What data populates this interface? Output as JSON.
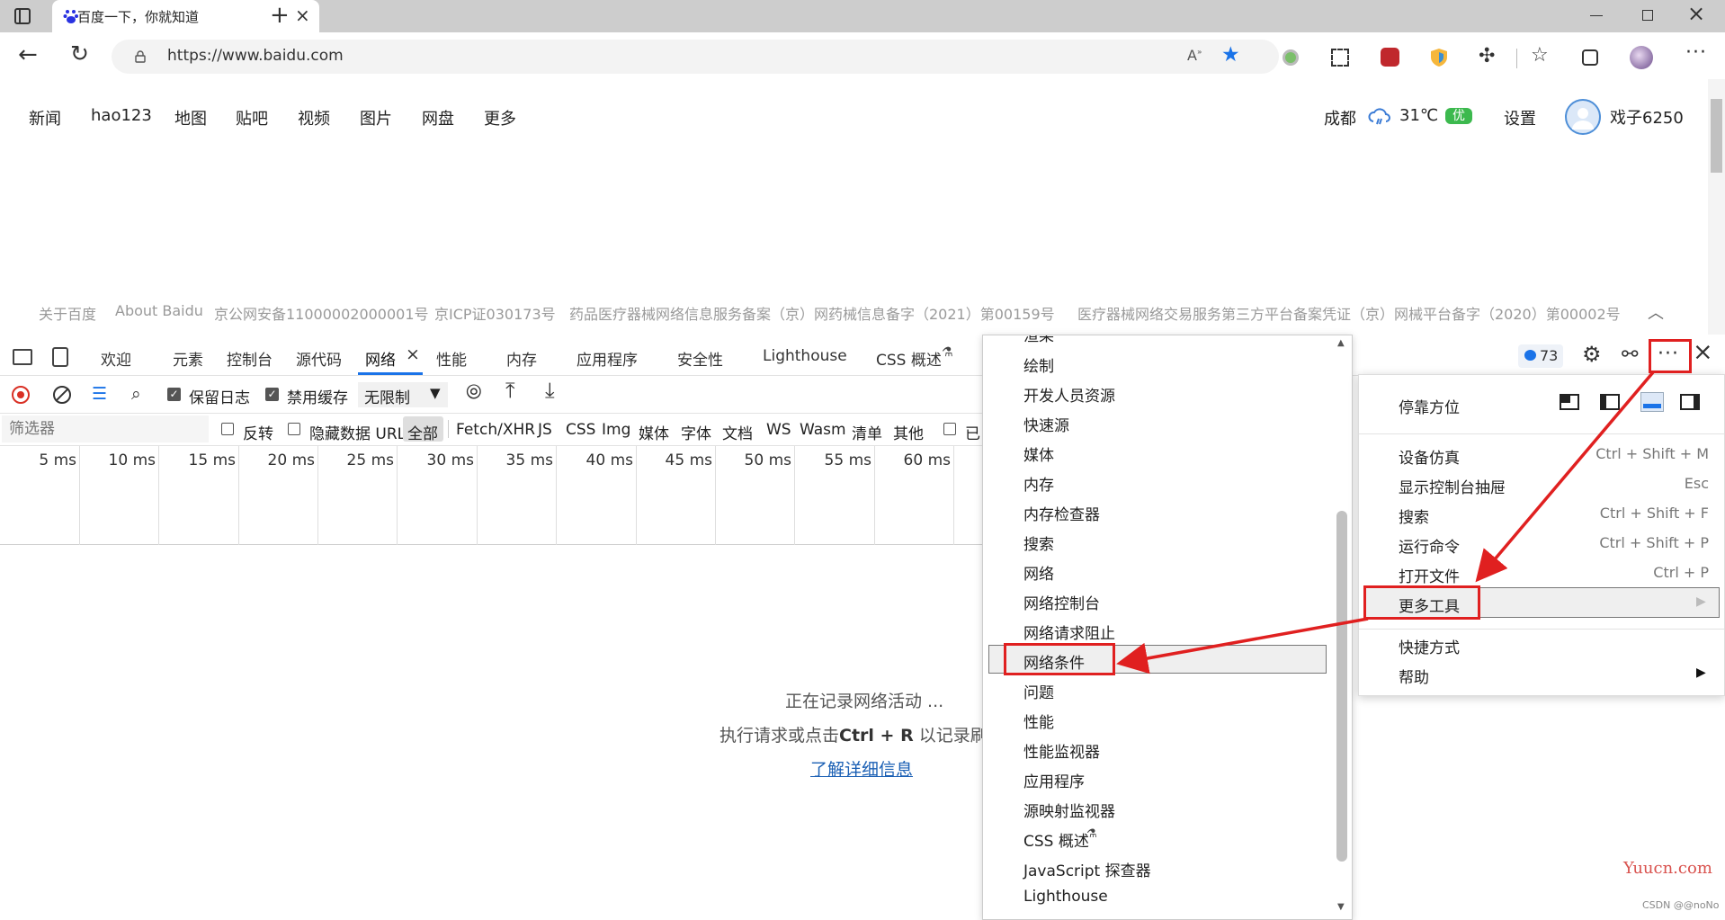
{
  "browser": {
    "tab_title": "百度一下，你就知道",
    "url": "https://www.baidu.com"
  },
  "page": {
    "nav_links": [
      "新闻",
      "hao123",
      "地图",
      "贴吧",
      "视频",
      "图片",
      "网盘",
      "更多"
    ],
    "city": "成都",
    "temperature": "31℃",
    "air_quality": "优",
    "settings_label": "设置",
    "username": "戏子6250",
    "footer_links": [
      "关于百度",
      "About Baidu",
      "京公网安备11000002000001号",
      "京ICP证030173号",
      "药品医疗器械网络信息服务备案（京）网药械信息备字（2021）第00159号",
      "医疗器械网络交易服务第三方平台备案凭证（京）网械平台备字（2020）第00002号"
    ]
  },
  "devtools": {
    "tabs": [
      "欢迎",
      "元素",
      "控制台",
      "源代码",
      "网络",
      "性能",
      "内存",
      "应用程序",
      "安全性",
      "Lighthouse",
      "CSS 概述"
    ],
    "active_tab": "网络",
    "issues_count": "73",
    "toolbar": {
      "preserve_log": "保留日志",
      "disable_cache": "禁用缓存",
      "throttling": "无限制"
    },
    "filter": {
      "placeholder": "筛选器",
      "invert": "反转",
      "hide_data_url": "隐藏数据 URL",
      "types": [
        "全部",
        "Fetch/XHR",
        "JS",
        "CSS",
        "Img",
        "媒体",
        "字体",
        "文档",
        "WS",
        "Wasm",
        "清单",
        "其他"
      ],
      "truncated": "已"
    },
    "timeline_ticks": [
      "5 ms",
      "10 ms",
      "15 ms",
      "20 ms",
      "25 ms",
      "30 ms",
      "35 ms",
      "40 ms",
      "45 ms",
      "50 ms",
      "55 ms",
      "60 ms"
    ],
    "empty_state": {
      "line1": "正在记录网络活动 ...",
      "line2_prefix": "执行请求或点击",
      "line2_bold": "Ctrl + R",
      "line2_suffix": " 以记录刷新",
      "link": "了解详细信息"
    }
  },
  "more_tools_menu": {
    "items": [
      "渲染",
      "绘制",
      "开发人员资源",
      "快速源",
      "媒体",
      "内存",
      "内存检查器",
      "搜索",
      "网络",
      "网络控制台",
      "网络请求阻止",
      "网络条件",
      "问题",
      "性能",
      "性能监视器",
      "应用程序",
      "源映射监视器",
      "CSS 概述",
      "JavaScript 探查器",
      "Lighthouse"
    ],
    "highlighted": "网络条件"
  },
  "main_menu": {
    "dock_label": "停靠方位",
    "items": [
      {
        "label": "设备仿真",
        "shortcut": "Ctrl + Shift + M"
      },
      {
        "label": "显示控制台抽屉",
        "shortcut": "Esc"
      },
      {
        "label": "搜索",
        "shortcut": "Ctrl + Shift + F"
      },
      {
        "label": "运行命令",
        "shortcut": "Ctrl + Shift + P"
      },
      {
        "label": "打开文件",
        "shortcut": "Ctrl + P"
      },
      {
        "label": "更多工具",
        "shortcut": ""
      },
      {
        "label": "快捷方式",
        "shortcut": ""
      },
      {
        "label": "帮助",
        "shortcut": ""
      }
    ]
  },
  "watermark": {
    "site": "Yuucn.com",
    "credit": "CSDN @@noNo"
  },
  "colors": {
    "annotation_red": "#e02020",
    "link_blue": "#1a5fb4",
    "record_red": "#d93025",
    "aqi_green": "#3cb94e",
    "star_blue": "#1a73e8"
  }
}
